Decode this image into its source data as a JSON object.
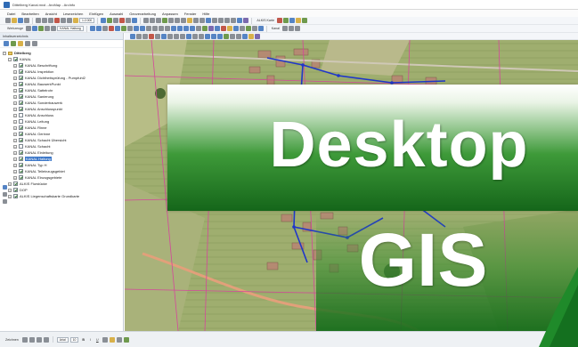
{
  "window": {
    "title": "Dittelberg Kanal.mxd - ArcMap - ArcInfo"
  },
  "menu": [
    "Datei",
    "Bearbeiten",
    "Ansicht",
    "Lesezeichen",
    "Einfügen",
    "Auswahl",
    "Geoverarbeitung",
    "Anpassen",
    "Fenster",
    "Hilfe"
  ],
  "toolbar": {
    "scale_value": "1:2.000",
    "label_werkzeuge": "Werkzeuge",
    "layer_select": "KANAL Haltung",
    "label_alkis": "ALKIS Karte",
    "label_kanal": "Kanal"
  },
  "toc": {
    "title": "Inhaltsverzeichnis",
    "root": "Dittelberg",
    "group_kanal": "KANAL",
    "layers": [
      {
        "label": "KANAL Beschriftung",
        "checked": true
      },
      {
        "label": "KANAL Inspektion",
        "checked": true
      },
      {
        "label": "KANAL Dichtheitsprüfung - Pumpfuhl2",
        "checked": true
      },
      {
        "label": "KANAL BauwerkPunkt",
        "checked": true
      },
      {
        "label": "KANAL Sattelrohr",
        "checked": true
      },
      {
        "label": "KANAL Sanierung",
        "checked": true
      },
      {
        "label": "KANAL Sonderbauwerk",
        "checked": true
      },
      {
        "label": "KANAL Anschlusspunkt",
        "checked": true
      },
      {
        "label": "KANAL Anschluss",
        "checked": false
      },
      {
        "label": "KANAL Leitung",
        "checked": false
      },
      {
        "label": "KANAL Rinne",
        "checked": true
      },
      {
        "label": "KANAL Gerinne",
        "checked": true
      },
      {
        "label": "KANAL Schacht Übersicht",
        "checked": true
      },
      {
        "label": "KANAL Schacht",
        "checked": false
      },
      {
        "label": "KANAL Einleitung",
        "checked": true
      },
      {
        "label": "KANAL Haltung",
        "checked": true,
        "selected": true
      },
      {
        "label": "KANAL Typ H",
        "checked": true
      },
      {
        "label": "KANAL Teileinzugsgebiet",
        "checked": true
      },
      {
        "label": "KANAL Einzugsgebiete",
        "checked": true
      }
    ],
    "bottom_groups": [
      "ALKIS Flurstücke",
      "DOP",
      "ALKIS Liegenschaftskarte Grundkarte"
    ]
  },
  "statusbar": {
    "zeichnen_label": "Zeichnen",
    "font_select": "Arial",
    "size_select": "10"
  },
  "overlay": {
    "title_line1": "Desktop",
    "title_line2": "GIS"
  },
  "colors": {
    "overlay_green_dark": "#15661a",
    "overlay_green_mid": "#3e9a39",
    "selection_blue": "#3d78c9",
    "pipe_line": "#1f36c9",
    "parcel_line": "#d4479b",
    "road_line": "#e2a07a"
  }
}
